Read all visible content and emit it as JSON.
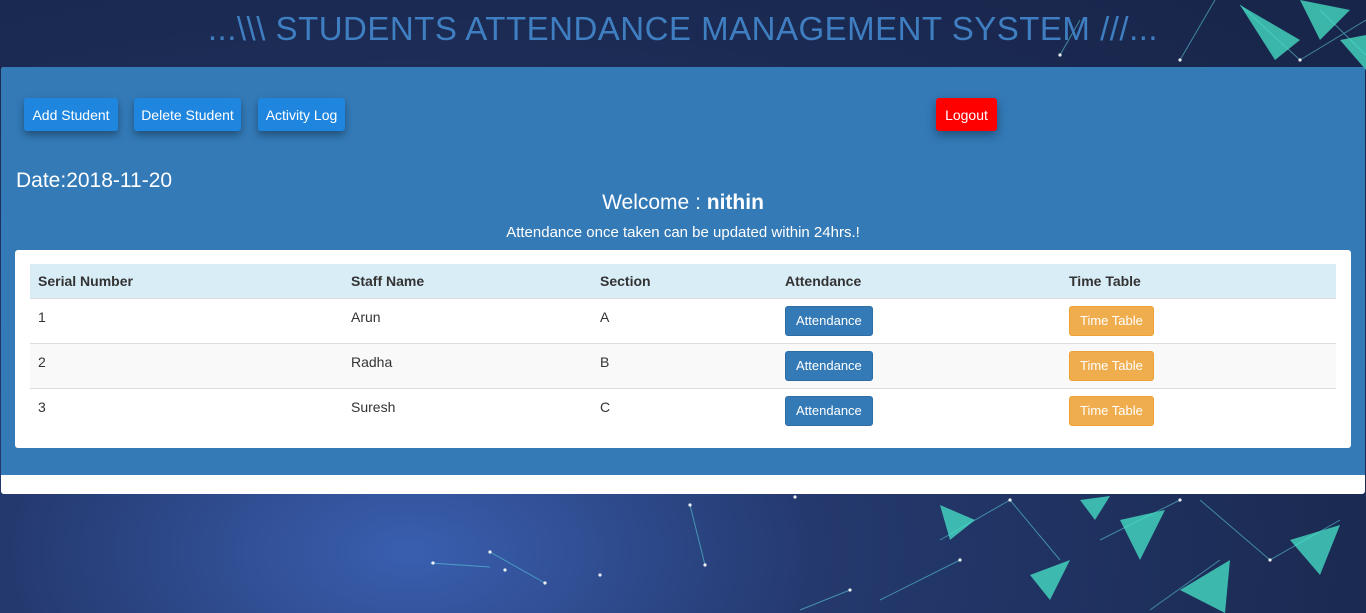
{
  "header": {
    "title": "...\\\\\\ STUDENTS ATTENDANCE MANAGEMENT SYSTEM ///..."
  },
  "toolbar": {
    "add_student": "Add Student",
    "delete_student": "Delete Student",
    "activity_log": "Activity Log",
    "logout": "Logout"
  },
  "info": {
    "date": "Date:2018-11-20",
    "welcome_prefix": "Welcome : ",
    "username": "nithin",
    "note": "Attendance once taken can be updated within 24hrs.!"
  },
  "table": {
    "headers": [
      "Serial Number",
      "Staff Name",
      "Section",
      "Attendance",
      "Time Table"
    ],
    "rows": [
      {
        "serial": "1",
        "name": "Arun",
        "section": "A",
        "attendance": "Attendance",
        "timetable": "Time Table"
      },
      {
        "serial": "2",
        "name": "Radha",
        "section": "B",
        "attendance": "Attendance",
        "timetable": "Time Table"
      },
      {
        "serial": "3",
        "name": "Suresh",
        "section": "C",
        "attendance": "Attendance",
        "timetable": "Time Table"
      }
    ]
  },
  "colors": {
    "panel": "#337ab7",
    "nav_button": "#1f86e0",
    "logout_button": "#ff0000",
    "attendance_button": "#337ab7",
    "timetable_button": "#f0ad4e",
    "table_header": "#d9edf7"
  }
}
